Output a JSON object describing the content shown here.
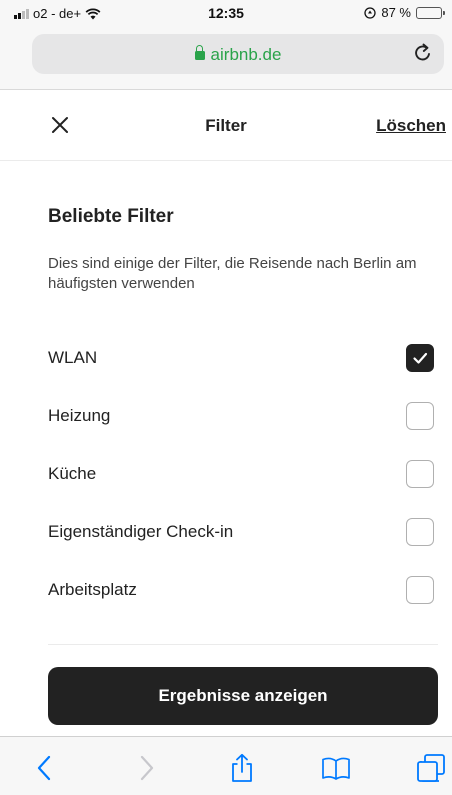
{
  "status_bar": {
    "carrier": "o2 - de+",
    "time": "12:35",
    "battery_text": "87 %",
    "battery_level": 0.87,
    "battery_color": "#34c759"
  },
  "browser": {
    "url": "airbnb.de",
    "url_color": "#2aa34a"
  },
  "header": {
    "title": "Filter",
    "clear_label": "Löschen"
  },
  "popular": {
    "title": "Beliebte Filter",
    "description": "Dies sind einige der Filter, die Reisende nach Berlin am häufigsten verwenden",
    "items": [
      {
        "label": "WLAN",
        "checked": true
      },
      {
        "label": "Heizung",
        "checked": false
      },
      {
        "label": "Küche",
        "checked": false
      },
      {
        "label": "Eigenständiger Check-in",
        "checked": false
      },
      {
        "label": "Arbeitsplatz",
        "checked": false
      }
    ]
  },
  "footer": {
    "results_label": "Ergebnisse anzeigen"
  },
  "toolbar": {
    "icons": [
      "back-icon",
      "forward-icon",
      "share-icon",
      "bookmarks-icon",
      "tabs-icon"
    ],
    "accent": "#007aff"
  }
}
